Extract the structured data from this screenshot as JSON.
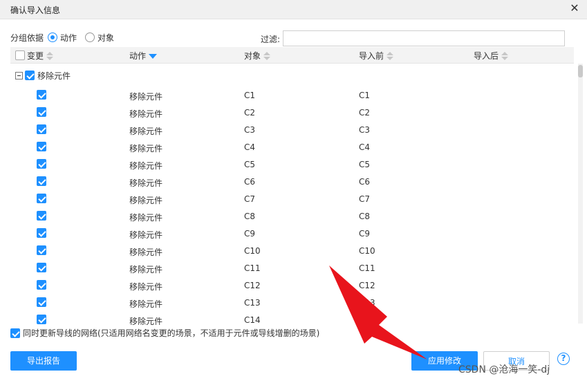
{
  "dialog": {
    "title": "确认导入信息",
    "close_icon": "close-icon"
  },
  "group_by": {
    "label": "分组依据",
    "options": [
      {
        "label": "动作",
        "selected": true
      },
      {
        "label": "对象",
        "selected": false
      }
    ]
  },
  "filter": {
    "label": "过滤:",
    "value": "",
    "placeholder": ""
  },
  "table": {
    "columns": [
      {
        "label": "变更",
        "sort": "none"
      },
      {
        "label": "动作",
        "sort": "desc"
      },
      {
        "label": "对象",
        "sort": "none"
      },
      {
        "label": "导入前",
        "sort": "none"
      },
      {
        "label": "导入后",
        "sort": "none"
      }
    ],
    "group": {
      "label": "移除元件",
      "checked": true,
      "expanded": true
    },
    "rows": [
      {
        "checked": true,
        "action": "移除元件",
        "object": "C1",
        "before": "C1",
        "after": ""
      },
      {
        "checked": true,
        "action": "移除元件",
        "object": "C2",
        "before": "C2",
        "after": ""
      },
      {
        "checked": true,
        "action": "移除元件",
        "object": "C3",
        "before": "C3",
        "after": ""
      },
      {
        "checked": true,
        "action": "移除元件",
        "object": "C4",
        "before": "C4",
        "after": ""
      },
      {
        "checked": true,
        "action": "移除元件",
        "object": "C5",
        "before": "C5",
        "after": ""
      },
      {
        "checked": true,
        "action": "移除元件",
        "object": "C6",
        "before": "C6",
        "after": ""
      },
      {
        "checked": true,
        "action": "移除元件",
        "object": "C7",
        "before": "C7",
        "after": ""
      },
      {
        "checked": true,
        "action": "移除元件",
        "object": "C8",
        "before": "C8",
        "after": ""
      },
      {
        "checked": true,
        "action": "移除元件",
        "object": "C9",
        "before": "C9",
        "after": ""
      },
      {
        "checked": true,
        "action": "移除元件",
        "object": "C10",
        "before": "C10",
        "after": ""
      },
      {
        "checked": true,
        "action": "移除元件",
        "object": "C11",
        "before": "C11",
        "after": ""
      },
      {
        "checked": true,
        "action": "移除元件",
        "object": "C12",
        "before": "C12",
        "after": ""
      },
      {
        "checked": true,
        "action": "移除元件",
        "object": "C13",
        "before": "C13",
        "after": ""
      },
      {
        "checked": true,
        "action": "移除元件",
        "object": "C14",
        "before": "C14",
        "after": ""
      }
    ]
  },
  "sync_option": {
    "checked": true,
    "label": "同时更新导线的网络(只适用网络名变更的场景，不适用于元件或导线增删的场景)"
  },
  "buttons": {
    "export": "导出报告",
    "apply": "应用修改",
    "cancel": "取消",
    "help": "?"
  },
  "watermark": "CSDN @沧海一笑-dj",
  "colors": {
    "accent": "#1e90ff",
    "annotation_arrow": "#e8141c"
  }
}
